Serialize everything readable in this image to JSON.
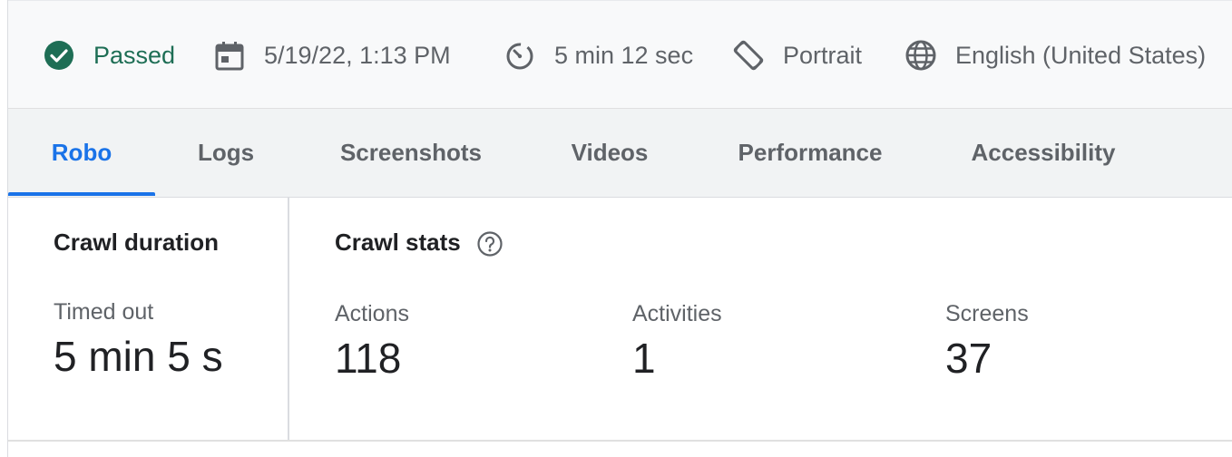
{
  "summary": {
    "status": "Passed",
    "datetime": "5/19/22, 1:13 PM",
    "duration": "5 min 12 sec",
    "orientation": "Portrait",
    "locale": "English (United States)"
  },
  "tabs": [
    {
      "label": "Robo",
      "active": true
    },
    {
      "label": "Logs",
      "active": false
    },
    {
      "label": "Screenshots",
      "active": false
    },
    {
      "label": "Videos",
      "active": false
    },
    {
      "label": "Performance",
      "active": false
    },
    {
      "label": "Accessibility",
      "active": false
    }
  ],
  "crawl_duration": {
    "heading": "Crawl duration",
    "label": "Timed out",
    "value": "5 min 5 s"
  },
  "crawl_stats": {
    "heading": "Crawl stats",
    "items": [
      {
        "label": "Actions",
        "value": "118"
      },
      {
        "label": "Activities",
        "value": "1"
      },
      {
        "label": "Screens",
        "value": "37"
      }
    ]
  },
  "colors": {
    "accent": "#1a73e8",
    "passed": "#1e6e55"
  },
  "icons": {
    "status": "check-circle-icon",
    "datetime": "calendar-icon",
    "duration": "timer-icon",
    "orientation": "screen-rotation-icon",
    "locale": "globe-icon",
    "help": "help-circle-icon"
  }
}
